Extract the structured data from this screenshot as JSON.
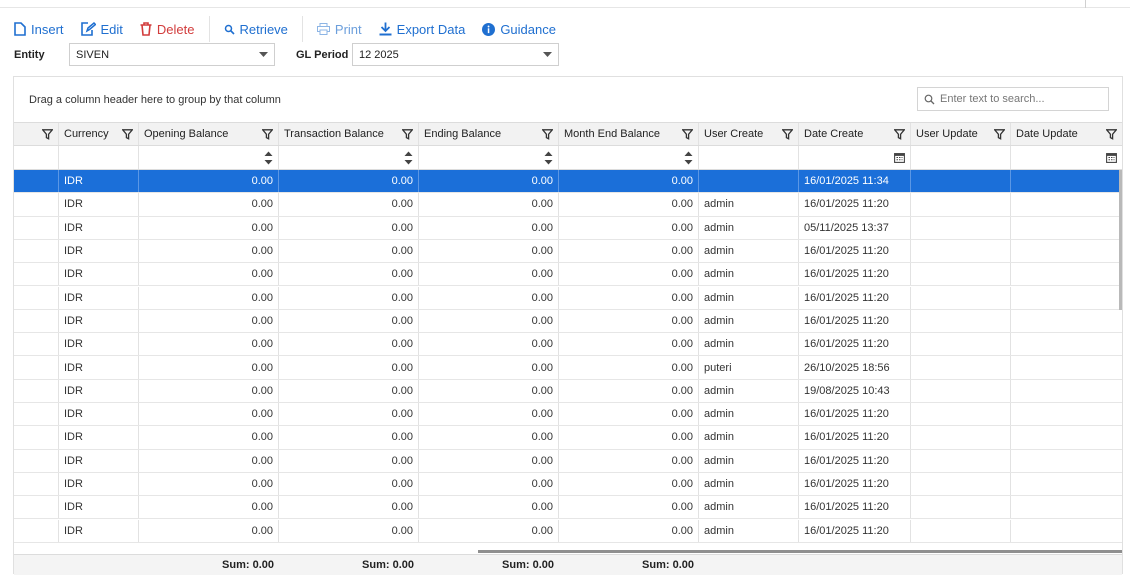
{
  "toolbar": {
    "insert": "Insert",
    "edit": "Edit",
    "delete": "Delete",
    "retrieve": "Retrieve",
    "print": "Print",
    "export": "Export Data",
    "guidance": "Guidance"
  },
  "filters": {
    "entity_label": "Entity",
    "entity_value": "SIVEN",
    "period_label": "GL Period",
    "period_value": "12 2025"
  },
  "grid": {
    "group_hint": "Drag a column header here to group by that column",
    "search_placeholder": "Enter text to search...",
    "columns": [
      "Currency",
      "Opening Balance",
      "Transaction Balance",
      "Ending Balance",
      "Month End Balance",
      "User Create",
      "Date Create",
      "User Update",
      "Date Update"
    ],
    "rows": [
      {
        "currency": "IDR",
        "opening": "0.00",
        "transaction": "0.00",
        "ending": "0.00",
        "month_end": "0.00",
        "user_create": "",
        "date_create": "16/01/2025 11:34",
        "user_update": "",
        "date_update": ""
      },
      {
        "currency": "IDR",
        "opening": "0.00",
        "transaction": "0.00",
        "ending": "0.00",
        "month_end": "0.00",
        "user_create": "admin",
        "date_create": "16/01/2025 11:20",
        "user_update": "",
        "date_update": ""
      },
      {
        "currency": "IDR",
        "opening": "0.00",
        "transaction": "0.00",
        "ending": "0.00",
        "month_end": "0.00",
        "user_create": "admin",
        "date_create": "05/11/2025 13:37",
        "user_update": "",
        "date_update": ""
      },
      {
        "currency": "IDR",
        "opening": "0.00",
        "transaction": "0.00",
        "ending": "0.00",
        "month_end": "0.00",
        "user_create": "admin",
        "date_create": "16/01/2025 11:20",
        "user_update": "",
        "date_update": ""
      },
      {
        "currency": "IDR",
        "opening": "0.00",
        "transaction": "0.00",
        "ending": "0.00",
        "month_end": "0.00",
        "user_create": "admin",
        "date_create": "16/01/2025 11:20",
        "user_update": "",
        "date_update": ""
      },
      {
        "currency": "IDR",
        "opening": "0.00",
        "transaction": "0.00",
        "ending": "0.00",
        "month_end": "0.00",
        "user_create": "admin",
        "date_create": "16/01/2025 11:20",
        "user_update": "",
        "date_update": ""
      },
      {
        "currency": "IDR",
        "opening": "0.00",
        "transaction": "0.00",
        "ending": "0.00",
        "month_end": "0.00",
        "user_create": "admin",
        "date_create": "16/01/2025 11:20",
        "user_update": "",
        "date_update": ""
      },
      {
        "currency": "IDR",
        "opening": "0.00",
        "transaction": "0.00",
        "ending": "0.00",
        "month_end": "0.00",
        "user_create": "admin",
        "date_create": "16/01/2025 11:20",
        "user_update": "",
        "date_update": ""
      },
      {
        "currency": "IDR",
        "opening": "0.00",
        "transaction": "0.00",
        "ending": "0.00",
        "month_end": "0.00",
        "user_create": "puteri",
        "date_create": "26/10/2025 18:56",
        "user_update": "",
        "date_update": ""
      },
      {
        "currency": "IDR",
        "opening": "0.00",
        "transaction": "0.00",
        "ending": "0.00",
        "month_end": "0.00",
        "user_create": "admin",
        "date_create": "19/08/2025 10:43",
        "user_update": "",
        "date_update": ""
      },
      {
        "currency": "IDR",
        "opening": "0.00",
        "transaction": "0.00",
        "ending": "0.00",
        "month_end": "0.00",
        "user_create": "admin",
        "date_create": "16/01/2025 11:20",
        "user_update": "",
        "date_update": ""
      },
      {
        "currency": "IDR",
        "opening": "0.00",
        "transaction": "0.00",
        "ending": "0.00",
        "month_end": "0.00",
        "user_create": "admin",
        "date_create": "16/01/2025 11:20",
        "user_update": "",
        "date_update": ""
      },
      {
        "currency": "IDR",
        "opening": "0.00",
        "transaction": "0.00",
        "ending": "0.00",
        "month_end": "0.00",
        "user_create": "admin",
        "date_create": "16/01/2025 11:20",
        "user_update": "",
        "date_update": ""
      },
      {
        "currency": "IDR",
        "opening": "0.00",
        "transaction": "0.00",
        "ending": "0.00",
        "month_end": "0.00",
        "user_create": "admin",
        "date_create": "16/01/2025 11:20",
        "user_update": "",
        "date_update": ""
      },
      {
        "currency": "IDR",
        "opening": "0.00",
        "transaction": "0.00",
        "ending": "0.00",
        "month_end": "0.00",
        "user_create": "admin",
        "date_create": "16/01/2025 11:20",
        "user_update": "",
        "date_update": ""
      },
      {
        "currency": "IDR",
        "opening": "0.00",
        "transaction": "0.00",
        "ending": "0.00",
        "month_end": "0.00",
        "user_create": "admin",
        "date_create": "16/01/2025 11:20",
        "user_update": "",
        "date_update": ""
      }
    ],
    "selected_row_index": 0,
    "summary": {
      "opening": "Sum: 0.00",
      "transaction": "Sum: 0.00",
      "ending": "Sum: 0.00",
      "month_end": "Sum: 0.00"
    }
  },
  "colors": {
    "accent": "#1f6fd0",
    "selected_row": "#1b6fd9",
    "delete": "#d23c3c"
  },
  "icons": {
    "insert": "document-icon",
    "edit": "edit-icon",
    "delete": "trash-icon",
    "retrieve": "search-icon",
    "print": "printer-icon",
    "export": "download-icon",
    "guidance": "info-icon",
    "filter": "filter-icon",
    "date": "calendar-icon"
  }
}
